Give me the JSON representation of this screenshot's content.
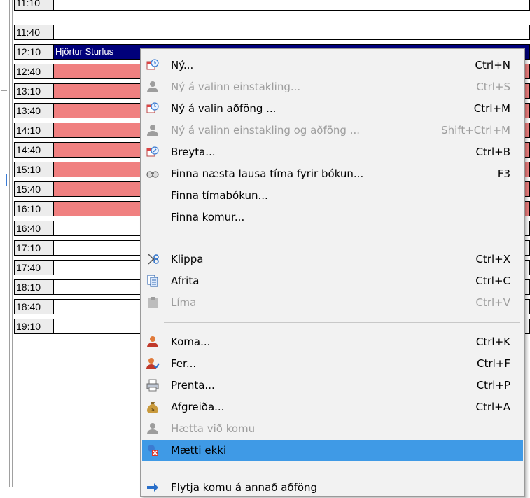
{
  "schedule": {
    "rows": [
      {
        "time": "11:10",
        "state": "free",
        "text": ""
      },
      {
        "time": "11:40",
        "state": "free",
        "text": ""
      },
      {
        "time": "12:10",
        "state": "selected",
        "text": "Hjörtur Sturlus"
      },
      {
        "time": "12:40",
        "state": "booked",
        "text": ""
      },
      {
        "time": "13:10",
        "state": "booked",
        "text": ""
      },
      {
        "time": "13:40",
        "state": "booked",
        "text": ""
      },
      {
        "time": "14:10",
        "state": "booked",
        "text": ""
      },
      {
        "time": "14:40",
        "state": "booked",
        "text": ""
      },
      {
        "time": "15:10",
        "state": "booked",
        "text": ""
      },
      {
        "time": "15:40",
        "state": "booked",
        "text": ""
      },
      {
        "time": "16:10",
        "state": "booked",
        "text": ""
      },
      {
        "time": "16:40",
        "state": "free",
        "text": ""
      },
      {
        "time": "17:10",
        "state": "free",
        "text": ""
      },
      {
        "time": "17:40",
        "state": "free",
        "text": ""
      },
      {
        "time": "18:10",
        "state": "free",
        "text": ""
      },
      {
        "time": "18:40",
        "state": "free",
        "text": ""
      },
      {
        "time": "19:10",
        "state": "free",
        "text": ""
      }
    ]
  },
  "context_menu": {
    "items": [
      {
        "label": "Ný...",
        "shortcut": "Ctrl+N",
        "icon": "calendar-clock-icon",
        "disabled": false
      },
      {
        "label": "Ný á valinn einstakling...",
        "shortcut": "Ctrl+S",
        "icon": "person-icon",
        "disabled": true
      },
      {
        "label": "Ný á valin aðföng ...",
        "shortcut": "Ctrl+M",
        "icon": "calendar-clock-icon",
        "disabled": false
      },
      {
        "label": "Ný á valinn einstakling og aðföng ...",
        "shortcut": "Shift+Ctrl+M",
        "icon": "person-icon",
        "disabled": true
      },
      {
        "label": "Breyta...",
        "shortcut": "Ctrl+B",
        "icon": "calendar-edit-icon",
        "disabled": false
      },
      {
        "label": "Finna næsta lausa tíma fyrir bókun...",
        "shortcut": "F3",
        "icon": "binoculars-icon",
        "disabled": false
      },
      {
        "label": "Finna tímabókun...",
        "shortcut": "",
        "icon": "",
        "disabled": false
      },
      {
        "label": "Finna komur...",
        "shortcut": "",
        "icon": "",
        "disabled": false
      },
      {
        "label": "Klippa",
        "shortcut": "Ctrl+X",
        "icon": "scissors-icon",
        "disabled": false
      },
      {
        "label": "Afrita",
        "shortcut": "Ctrl+C",
        "icon": "copy-icon",
        "disabled": false
      },
      {
        "label": "Líma",
        "shortcut": "Ctrl+V",
        "icon": "paste-icon",
        "disabled": true
      },
      {
        "label": "Koma...",
        "shortcut": "Ctrl+K",
        "icon": "person-arrive-icon",
        "disabled": false
      },
      {
        "label": "Fer...",
        "shortcut": "Ctrl+F",
        "icon": "person-leave-icon",
        "disabled": false
      },
      {
        "label": "Prenta...",
        "shortcut": "Ctrl+P",
        "icon": "printer-icon",
        "disabled": false
      },
      {
        "label": "Afgreiða...",
        "shortcut": "Ctrl+A",
        "icon": "money-bag-icon",
        "disabled": false
      },
      {
        "label": "Hætta við komu",
        "shortcut": "",
        "icon": "person-icon",
        "disabled": true
      },
      {
        "label": "Mætti ekki",
        "shortcut": "",
        "icon": "no-show-icon",
        "disabled": false
      },
      {
        "label": "Flytja komu á annað aðföng",
        "shortcut": "",
        "icon": "arrow-icon",
        "disabled": false
      }
    ]
  },
  "colors": {
    "booked": "#f08080",
    "selected": "#00007a",
    "menu_highlight": "#3f9ae6"
  }
}
